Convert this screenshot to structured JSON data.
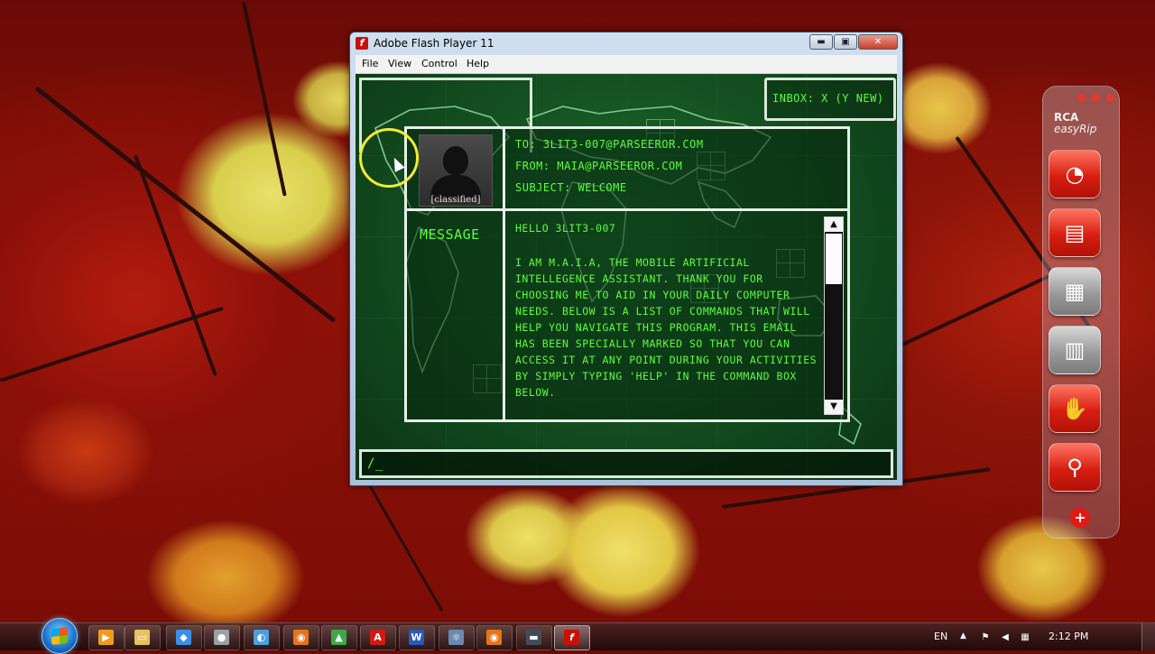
{
  "window": {
    "title": "Adobe Flash Player 11",
    "minimize_glyph": "▬",
    "maximize_glyph": "▣",
    "close_glyph": "✕",
    "menu": [
      "File",
      "View",
      "Control",
      "Help"
    ]
  },
  "flash_app": {
    "inbox_label": "INBOX: X (Y NEW)",
    "avatar_caption": "[classified]",
    "to_line": "TO: 3LIT3-007@PARSEEROR.COM",
    "from_line": "FROM: MAIA@PARSEEROR.COM",
    "subject_line": "SUBJECT: WELCOME",
    "message_label": "MESSAGE",
    "greeting": "HELLO 3LIT3-007",
    "body": "I AM M.A.I.A, THE MOBILE ARTIFICIAL INTELLEGENCE ASSISTANT. THANK YOU FOR CHOOSING ME TO AID IN YOUR DAILY COMPUTER NEEDS. BELOW IS A LIST OF COMMANDS THAT WILL HELP YOU NAVIGATE THIS PROGRAM. THIS EMAIL HAS BEEN SPECIALLY MARKED SO THAT YOU CAN ACCESS IT AT ANY POINT DURING YOUR ACTIVITIES BY SIMPLY TYPING 'HELP' IN THE COMMAND BOX BELOW.",
    "command_value": "/_",
    "scroll_up": "▲",
    "scroll_down": "▼"
  },
  "rca_dock": {
    "brand": "RCA",
    "product": "easyRip",
    "buttons": [
      {
        "icon": "disc-icon",
        "glyph": "◔",
        "style": "red"
      },
      {
        "icon": "laptop-files-icon",
        "glyph": "▤",
        "style": "red"
      },
      {
        "icon": "media-devices-icon",
        "glyph": "▦",
        "style": "grey"
      },
      {
        "icon": "player-folder-icon",
        "glyph": "▥",
        "style": "grey"
      },
      {
        "icon": "handshake-icon",
        "glyph": "✋",
        "style": "red"
      },
      {
        "icon": "microphone-icon",
        "glyph": "⚲",
        "style": "red"
      }
    ],
    "add_glyph": "+"
  },
  "taskbar": {
    "items": [
      {
        "name": "media-player-icon",
        "glyph": "▶",
        "color": "#f29a1a"
      },
      {
        "name": "explorer-icon",
        "glyph": "▭",
        "color": "#e8c25a"
      },
      {
        "name": "dropbox-icon",
        "glyph": "◆",
        "color": "#3d8ee8"
      },
      {
        "name": "chat-icon",
        "glyph": "●",
        "color": "#e0e0e0"
      },
      {
        "name": "network-icon",
        "glyph": "◐",
        "color": "#4aa0e0"
      },
      {
        "name": "firefox-icon",
        "glyph": "◉",
        "color": "#e8741a"
      },
      {
        "name": "recycle-icon",
        "glyph": "▲",
        "color": "#3ca84a"
      },
      {
        "name": "acrobat-icon",
        "glyph": "A",
        "color": "#d01a14"
      },
      {
        "name": "word-icon",
        "glyph": "W",
        "color": "#2a5ab8"
      },
      {
        "name": "settings-app-icon",
        "glyph": "☼",
        "color": "#6a8ab0"
      },
      {
        "name": "firefox-window-icon",
        "glyph": "◉",
        "color": "#e8741a"
      },
      {
        "name": "app-window-icon",
        "glyph": "▬",
        "color": "#444c58"
      },
      {
        "name": "flash-player-icon",
        "glyph": "f",
        "color": "#c8100a"
      }
    ],
    "language": "EN",
    "time": "2:12 PM",
    "tray_up_glyph": "▲"
  }
}
